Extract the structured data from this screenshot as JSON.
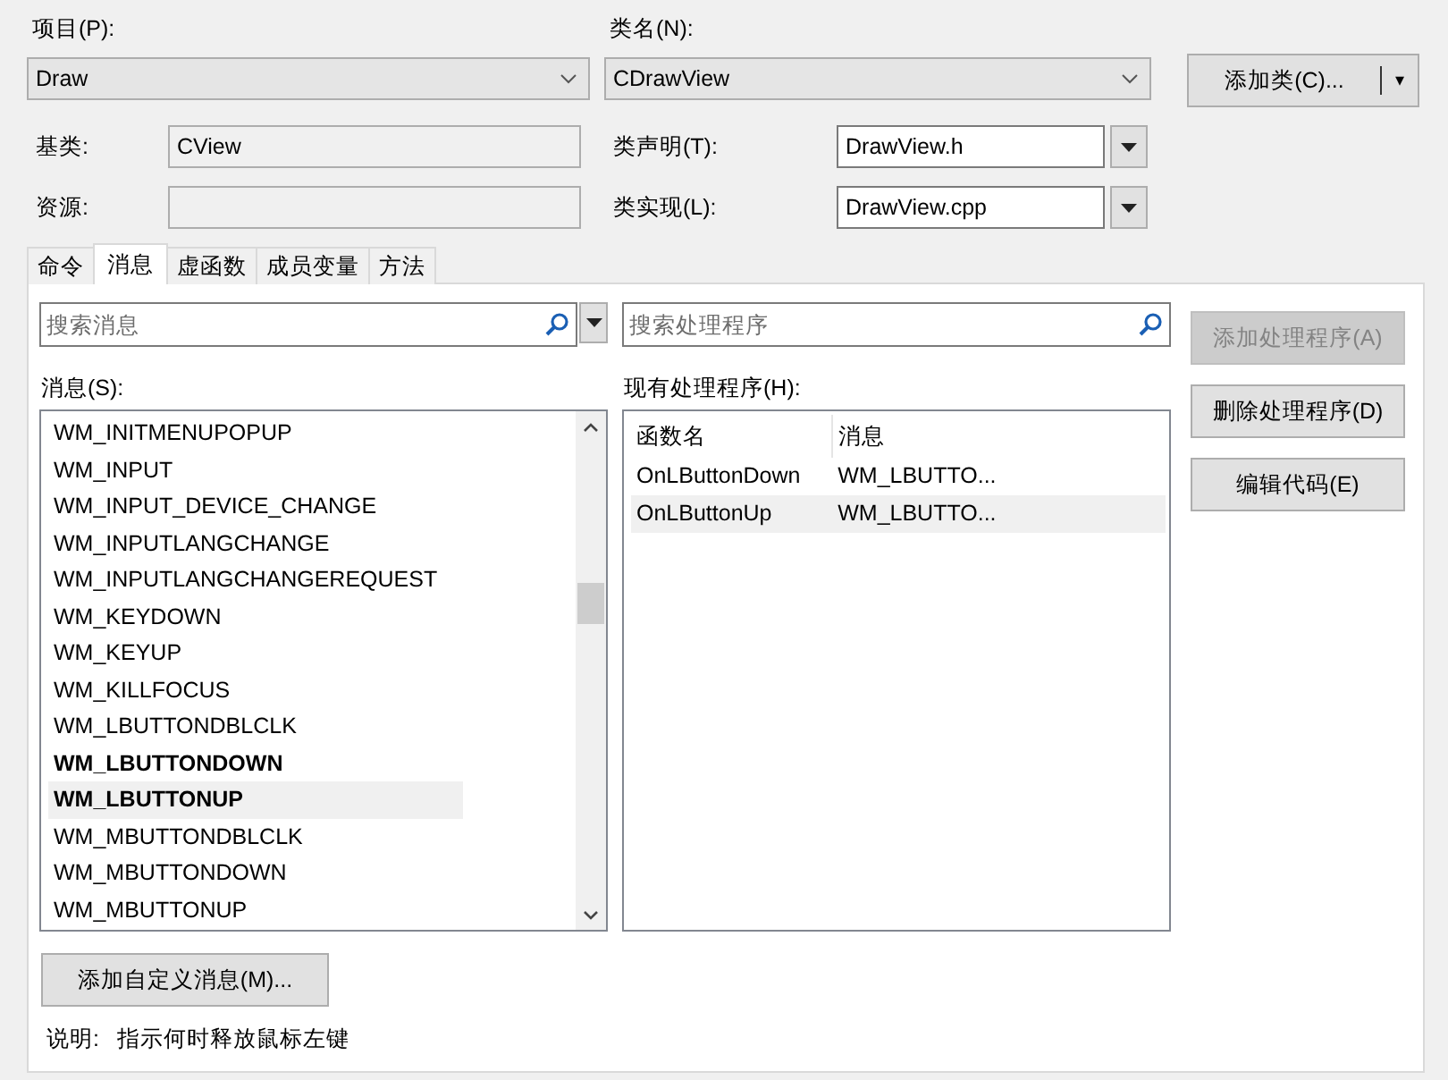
{
  "project": {
    "label": "项目(P):",
    "value": "Draw"
  },
  "class_name": {
    "label": "类名(N):",
    "value": "CDrawView"
  },
  "add_class_button": {
    "label": "添加类(C)...",
    "arrow": "▾"
  },
  "base_class": {
    "label": "基类:",
    "value": "CView"
  },
  "resource": {
    "label": "资源:"
  },
  "class_declaration": {
    "label": "类声明(T):",
    "value": "DrawView.h"
  },
  "class_implementation": {
    "label": "类实现(L):",
    "value": "DrawView.cpp"
  },
  "tabs": [
    {
      "label": "命令",
      "selected": false
    },
    {
      "label": "消息",
      "selected": true
    },
    {
      "label": "虚函数",
      "selected": false
    },
    {
      "label": "成员变量",
      "selected": false
    },
    {
      "label": "方法",
      "selected": false
    }
  ],
  "message_search": {
    "placeholder": "搜索消息"
  },
  "handler_search": {
    "placeholder": "搜索处理程序"
  },
  "side_buttons": [
    {
      "label": "添加处理程序(A)",
      "disabled": true
    },
    {
      "label": "删除处理程序(D)",
      "disabled": false
    },
    {
      "label": "编辑代码(E)",
      "disabled": false
    }
  ],
  "messages": {
    "label": "消息(S):",
    "items": [
      {
        "label": "WM_INITMENUPOPUP",
        "bold": false,
        "selected": false
      },
      {
        "label": "WM_INPUT",
        "bold": false,
        "selected": false
      },
      {
        "label": "WM_INPUT_DEVICE_CHANGE",
        "bold": false,
        "selected": false
      },
      {
        "label": "WM_INPUTLANGCHANGE",
        "bold": false,
        "selected": false
      },
      {
        "label": "WM_INPUTLANGCHANGEREQUEST",
        "bold": false,
        "selected": false
      },
      {
        "label": "WM_KEYDOWN",
        "bold": false,
        "selected": false
      },
      {
        "label": "WM_KEYUP",
        "bold": false,
        "selected": false
      },
      {
        "label": "WM_KILLFOCUS",
        "bold": false,
        "selected": false
      },
      {
        "label": "WM_LBUTTONDBLCLK",
        "bold": false,
        "selected": false
      },
      {
        "label": "WM_LBUTTONDOWN",
        "bold": true,
        "selected": false
      },
      {
        "label": "WM_LBUTTONUP",
        "bold": true,
        "selected": true
      },
      {
        "label": "WM_MBUTTONDBLCLK",
        "bold": false,
        "selected": false
      },
      {
        "label": "WM_MBUTTONDOWN",
        "bold": false,
        "selected": false
      },
      {
        "label": "WM_MBUTTONUP",
        "bold": false,
        "selected": false
      }
    ]
  },
  "handlers": {
    "label": "现有处理程序(H):",
    "columns": [
      "函数名",
      "消息"
    ],
    "rows": [
      {
        "cells": [
          "OnLButtonDown",
          "WM_LBUTTO..."
        ],
        "selected": false
      },
      {
        "cells": [
          "OnLButtonUp",
          "WM_LBUTTO..."
        ],
        "selected": true
      }
    ]
  },
  "add_custom_message_button": {
    "label": "添加自定义消息(M)..."
  },
  "description": {
    "label": "说明:",
    "text": "指示何时释放鼠标左键"
  }
}
